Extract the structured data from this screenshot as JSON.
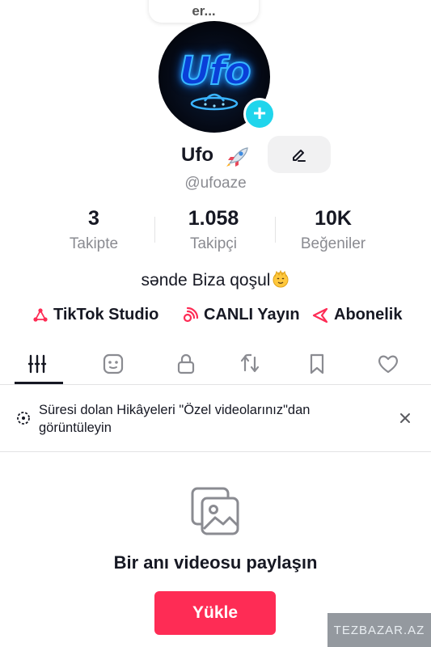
{
  "header": {
    "top_chip_text": "er..."
  },
  "profile": {
    "avatar_logo_text": "Ufo",
    "name": "Ufo",
    "name_emoji": "rocket",
    "handle": "@ufoaze",
    "add_badge": "+"
  },
  "stats": [
    {
      "value": "3",
      "label": "Takipte"
    },
    {
      "value": "1.058",
      "label": "Takipçi"
    },
    {
      "value": "10K",
      "label": "Beğeniler"
    }
  ],
  "bio": {
    "text": "sənde Biza qoşul",
    "emoji": "smiling-face"
  },
  "links": [
    {
      "label": "TikTok Studio",
      "icon": "studio-icon"
    },
    {
      "label": "CANLI Yayın",
      "icon": "live-icon"
    },
    {
      "label": "Abonelik",
      "icon": "subscription-icon"
    }
  ],
  "tabs": [
    {
      "name": "videos",
      "icon": "grid-bars-icon",
      "active": true
    },
    {
      "name": "stories",
      "icon": "face-story-icon"
    },
    {
      "name": "private",
      "icon": "lock-icon"
    },
    {
      "name": "reposts",
      "icon": "repost-icon"
    },
    {
      "name": "favorites",
      "icon": "bookmark-icon"
    },
    {
      "name": "liked",
      "icon": "heart-icon"
    }
  ],
  "notice": {
    "text": "Süresi dolan Hikâyeleri \"Özel videolarınız\"dan görüntüleyin",
    "close_icon": "close-icon"
  },
  "empty_state": {
    "icon": "photo-stack-icon",
    "title": "Bir anı videosu paylaşın",
    "button_label": "Yükle"
  },
  "watermark": "TEZBAZAR.AZ",
  "colors": {
    "accent": "#fe2c55",
    "badge": "#20d5ec",
    "text": "#161823",
    "muted": "#8a8b91"
  }
}
